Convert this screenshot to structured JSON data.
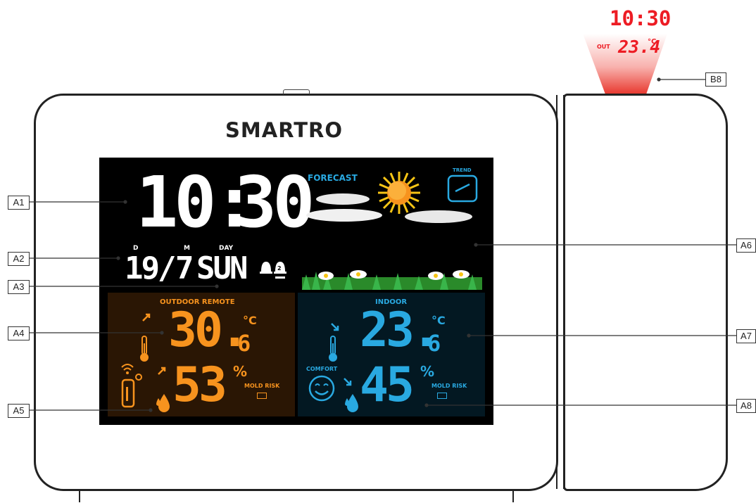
{
  "device": {
    "brand": "SMARTRO",
    "clock": {
      "hour": "10",
      "colon": ":",
      "minute": "30"
    },
    "date": {
      "day_label": "D",
      "month_label": "M",
      "dow_label": "DAY",
      "day": "19/",
      "month": "7",
      "weekday": "SUN"
    },
    "forecast": {
      "label": "FORECAST",
      "trend_label": "TREND"
    },
    "outdoor": {
      "label": "OUTDOOR REMOTE",
      "temp_main": "30.",
      "temp_dec": "6",
      "temp_unit": "°C",
      "humidity": "53",
      "humidity_unit": "%",
      "mold_label": "MOLD RISK"
    },
    "indoor": {
      "label": "INDOOR",
      "temp_main": "23.",
      "temp_dec": "6",
      "temp_unit": "°C",
      "humidity": "45",
      "humidity_unit": "%",
      "comfort_label": "COMFORT",
      "mold_label": "MOLD RISK"
    },
    "projection": {
      "time": "10:30",
      "out_label": "OUT",
      "temp": "23.4",
      "unit": "°C"
    }
  },
  "callouts": {
    "A1": "A1",
    "A2": "A2",
    "A3": "A3",
    "A4": "A4",
    "A5": "A5",
    "A6": "A6",
    "A7": "A7",
    "A8": "A8",
    "B8": "B8"
  },
  "colors": {
    "outdoor_text": "#f7931e",
    "outdoor_bg": "#2a1604",
    "indoor_text": "#29a9e1",
    "indoor_bg": "#031822",
    "projection": "#ed1c24"
  }
}
